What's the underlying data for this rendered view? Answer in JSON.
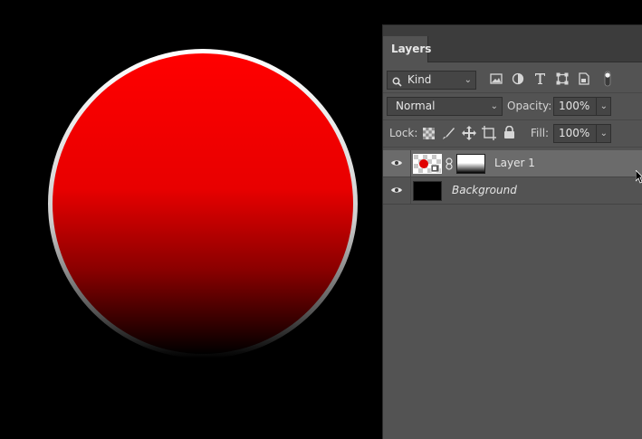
{
  "canvas": {
    "shape": "gradient-circle",
    "gradient_top_color": "#ff0000",
    "gradient_bottom_color": "#000000",
    "rim_color": "#e6e6e6"
  },
  "panel": {
    "tab_label": "Layers",
    "filter": {
      "icon": "search-icon",
      "label": "Kind"
    },
    "filter_icons": [
      "image-filter-icon",
      "adjustment-filter-icon",
      "type-filter-icon",
      "shape-filter-icon",
      "smart-object-filter-icon",
      "filter-toggle-icon"
    ],
    "blend_mode": "Normal",
    "opacity_label": "Opacity:",
    "opacity_value": "100%",
    "lock_label": "Lock:",
    "lock_icons": [
      "lock-transparent-pixels-icon",
      "lock-image-pixels-icon",
      "lock-position-icon",
      "lock-artboard-icon",
      "lock-all-icon"
    ],
    "fill_label": "Fill:",
    "fill_value": "100%",
    "layers": [
      {
        "name": "Layer 1",
        "selected": true,
        "visible": true,
        "has_mask": true
      },
      {
        "name": "Background",
        "selected": false,
        "visible": true,
        "italic": true
      }
    ]
  },
  "colors": {
    "panel_bg": "#535353",
    "tabbar_bg": "#3c3c3c",
    "selected_row": "#6b6b6b",
    "accent_red": "#ff0000"
  }
}
